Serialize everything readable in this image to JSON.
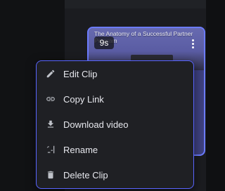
{
  "clip": {
    "title": "The Anatomy of a Successful Partner Program",
    "duration_badge": "9s",
    "more_icon": "more-vertical-icon",
    "accent_color": "#6c7cff"
  },
  "context_menu": {
    "border_color": "#5965ff",
    "items": [
      {
        "label": "Edit Clip",
        "icon": "pencil-icon"
      },
      {
        "label": "Copy Link",
        "icon": "link-icon"
      },
      {
        "label": "Download video",
        "icon": "download-icon"
      },
      {
        "label": "Rename",
        "icon": "rename-icon"
      },
      {
        "label": "Delete Clip",
        "icon": "trash-icon"
      }
    ]
  }
}
